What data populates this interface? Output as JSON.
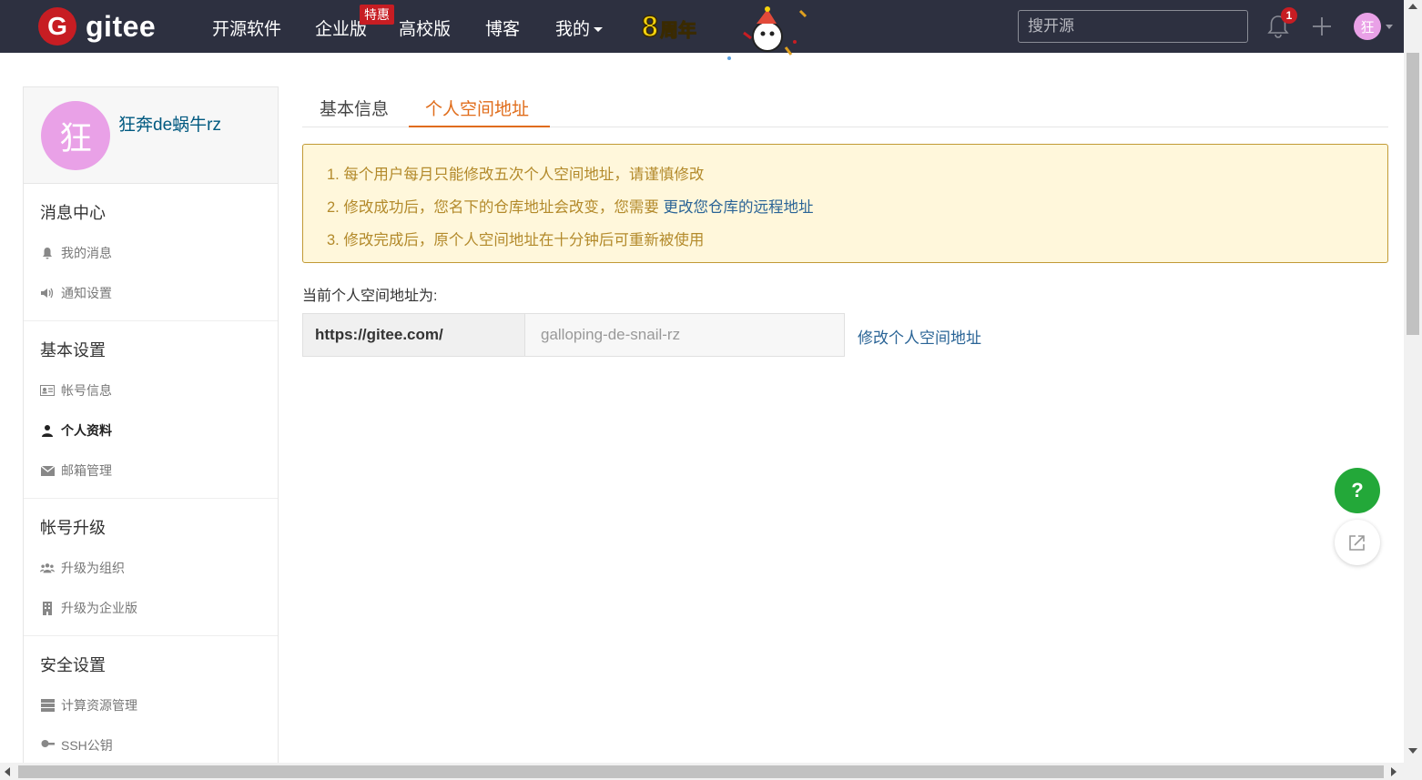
{
  "navbar": {
    "logo_letter": "G",
    "logo_text": "gitee",
    "items": [
      "开源软件",
      "企业版",
      "高校版",
      "博客",
      "我的"
    ],
    "hot_badge": "特惠",
    "anniversary": "8周年",
    "search_placeholder": "搜开源",
    "notification_count": "1",
    "avatar_letter": "狂"
  },
  "sidebar": {
    "avatar_letter": "狂",
    "username": "狂奔de蜗牛rz",
    "groups": [
      {
        "title": "消息中心",
        "items": [
          {
            "label": "我的消息",
            "icon": "bell-icon"
          },
          {
            "label": "通知设置",
            "icon": "volume-icon"
          }
        ]
      },
      {
        "title": "基本设置",
        "items": [
          {
            "label": "帐号信息",
            "icon": "id-card-icon"
          },
          {
            "label": "个人资料",
            "icon": "user-icon"
          },
          {
            "label": "邮箱管理",
            "icon": "envelope-icon"
          }
        ]
      },
      {
        "title": "帐号升级",
        "items": [
          {
            "label": "升级为组织",
            "icon": "users-icon"
          },
          {
            "label": "升级为企业版",
            "icon": "building-icon"
          }
        ]
      },
      {
        "title": "安全设置",
        "items": [
          {
            "label": "计算资源管理",
            "icon": "server-icon"
          },
          {
            "label": "SSH公钥",
            "icon": "key-icon"
          }
        ]
      }
    ]
  },
  "tabs": [
    {
      "label": "基本信息"
    },
    {
      "label": "个人空间地址"
    }
  ],
  "notice": {
    "line1": "1. 每个用户每月只能修改五次个人空间地址，请谨慎修改",
    "line2_prefix": "2. 修改成功后，您名下的仓库地址会改变，您需要 ",
    "line2_link": "更改您仓库的远程地址",
    "line3": "3. 修改完成后，原个人空间地址在十分钟后可重新被使用"
  },
  "space": {
    "label": "当前个人空间地址为:",
    "prefix": "https://gitee.com/",
    "value": "galloping-de-snail-rz",
    "edit_link": "修改个人空间地址"
  },
  "float": {
    "help": "?"
  }
}
